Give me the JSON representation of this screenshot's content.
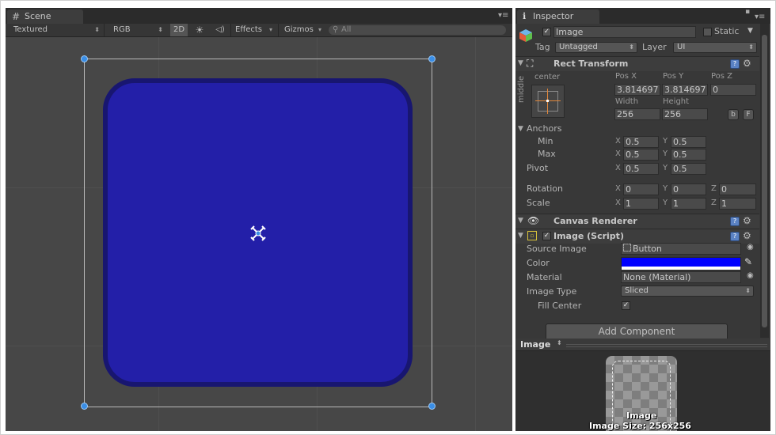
{
  "scene": {
    "tab_label": "Scene",
    "shading_mode": "Textured",
    "render_mode": "RGB",
    "mode_2d": "2D",
    "effects_label": "Effects",
    "gizmos_label": "Gizmos",
    "search_placeholder": "All"
  },
  "inspector": {
    "tab_label": "Inspector",
    "object_name": "Image",
    "active": true,
    "static_label": "Static",
    "tag_label": "Tag",
    "tag_value": "Untagged",
    "layer_label": "Layer",
    "layer_value": "UI",
    "rect_transform": {
      "title": "Rect Transform",
      "anchor_h": "center",
      "anchor_v": "middle",
      "pos_x_label": "Pos X",
      "pos_y_label": "Pos Y",
      "pos_z_label": "Pos Z",
      "pos_x": "3.814697",
      "pos_y": "3.814697",
      "pos_z": "0",
      "width_label": "Width",
      "height_label": "Height",
      "width": "256",
      "height": "256",
      "blueprint_btn": "b",
      "raw_btn": "F",
      "anchors_label": "Anchors",
      "min_label": "Min",
      "max_label": "Max",
      "pivot_label": "Pivot",
      "x_label": "X",
      "y_label": "Y",
      "z_label": "Z",
      "anchor_min_x": "0.5",
      "anchor_min_y": "0.5",
      "anchor_max_x": "0.5",
      "anchor_max_y": "0.5",
      "pivot_x": "0.5",
      "pivot_y": "0.5",
      "rotation_label": "Rotation",
      "rot_x": "0",
      "rot_y": "0",
      "rot_z": "0",
      "scale_label": "Scale",
      "scale_x": "1",
      "scale_y": "1",
      "scale_z": "1"
    },
    "canvas_renderer": {
      "title": "Canvas Renderer"
    },
    "image_script": {
      "title": "Image (Script)",
      "enabled": true,
      "source_image_label": "Source Image",
      "source_image": "Button",
      "color_label": "Color",
      "color_value": "#0000ff",
      "material_label": "Material",
      "material": "None (Material)",
      "image_type_label": "Image Type",
      "image_type": "Sliced",
      "fill_center_label": "Fill Center",
      "fill_center": true
    },
    "add_component": "Add Component",
    "preview": {
      "title": "Image",
      "caption_name": "Image",
      "caption_size": "Image Size: 256x256"
    }
  },
  "colors": {
    "image_blue": "#231fa8",
    "handle_blue": "#3a8ee6"
  }
}
